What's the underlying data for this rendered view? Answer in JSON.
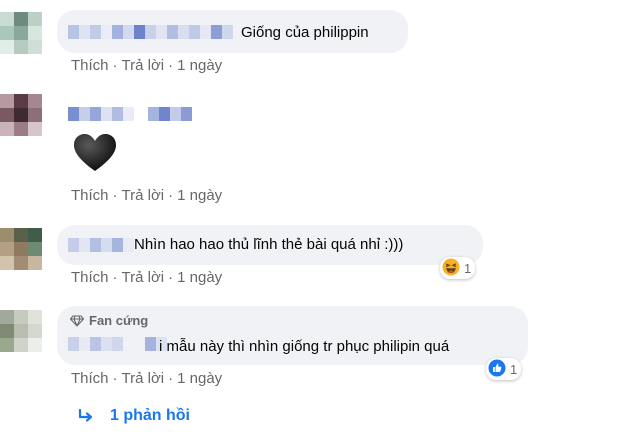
{
  "comments": [
    {
      "text": "Giống của philippin",
      "time": "1 ngày"
    },
    {
      "emoji": "black-heart",
      "time": "1 ngày"
    },
    {
      "text": "Nhìn hao hao thủ lĩnh thẻ bài quá nhỉ :)))",
      "time": "1 ngày",
      "reaction": {
        "type": "haha",
        "count": "1"
      }
    },
    {
      "badge": "Fan cứng",
      "text": "i mẫu này thì nhìn giống tr phục philipin quá",
      "time": "1 ngày",
      "reaction": {
        "type": "like",
        "count": "1"
      }
    }
  ],
  "labels": {
    "like": "Thích",
    "reply": "Trả lời",
    "dot": "·"
  },
  "replies": {
    "label": "1 phản hồi"
  },
  "colors": {
    "link": "#1877f2",
    "muted": "#65676b",
    "bubble": "#f0f2f5"
  }
}
